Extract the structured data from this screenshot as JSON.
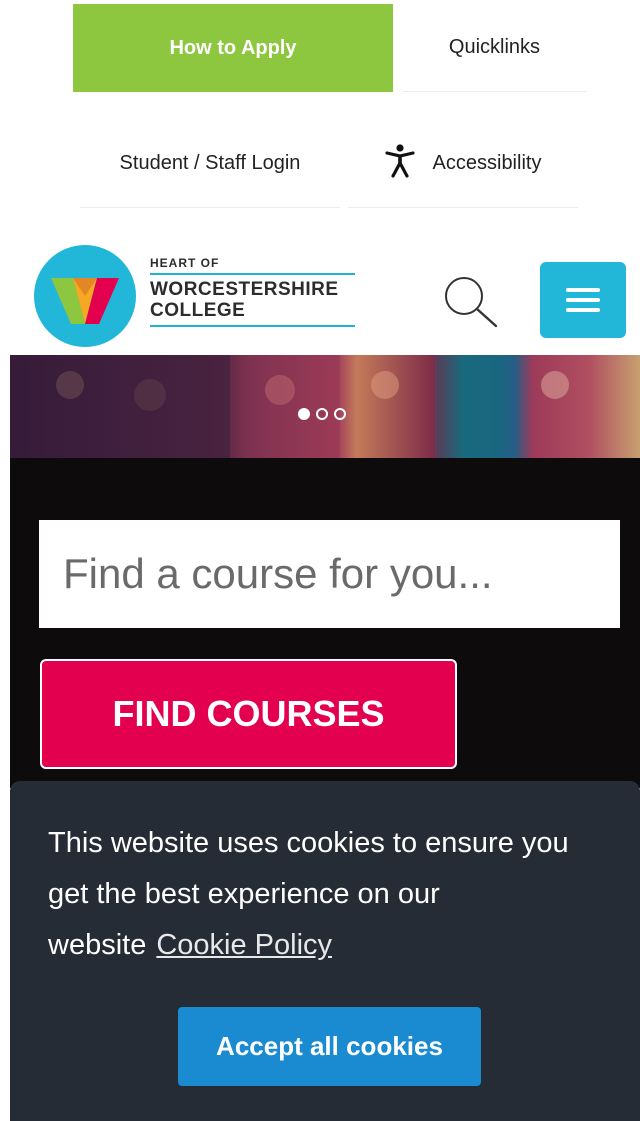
{
  "top_links": {
    "apply": "How to Apply",
    "quicklinks": "Quicklinks",
    "login": "Student / Staff Login",
    "accessibility": "Accessibility"
  },
  "logo": {
    "line1": "HEART OF",
    "line2": "WORCESTERSHIRE",
    "line3": "COLLEGE"
  },
  "hero": {
    "active_slide": 1,
    "slide_count": 3
  },
  "search": {
    "placeholder": "Find a course for you...",
    "button_label": "FIND COURSES"
  },
  "cookie_banner": {
    "message": "This website uses cookies to ensure you get the best experience on our website",
    "link_label": "Cookie Policy",
    "accept_label": "Accept all cookies"
  },
  "colors": {
    "apply_green": "#8dc63f",
    "brand_blue": "#22b7d9",
    "find_red": "#e3004f",
    "cookie_bg": "#252c36",
    "accept_blue": "#1a8bd0"
  }
}
